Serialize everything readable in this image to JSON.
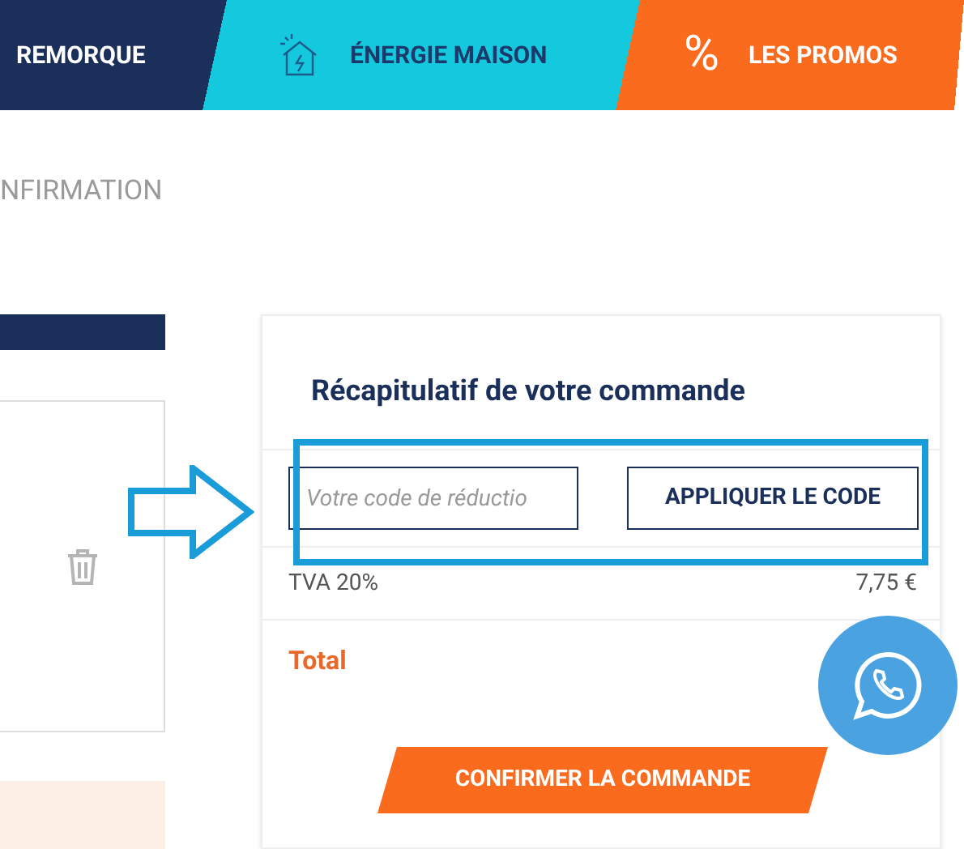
{
  "nav": [
    {
      "label": "REMORQUE",
      "kind": "plain"
    },
    {
      "label": "ÉNERGIE MAISON",
      "kind": "energy"
    },
    {
      "label": "LES PROMOS",
      "kind": "promo",
      "symbol": "%"
    }
  ],
  "breadcrumb": "NFIRMATION",
  "summary": {
    "title": "Récapitulatif de votre commande",
    "coupon": {
      "placeholder": "Votre code de réductio",
      "button": "APPLIQUER LE CODE"
    },
    "rows": [
      {
        "label": "TVA 20%",
        "value": "7,75 €",
        "kind": "line"
      },
      {
        "label": "Total",
        "kind": "total"
      }
    ],
    "confirm": "CONFIRMER LA COMMANDE"
  }
}
